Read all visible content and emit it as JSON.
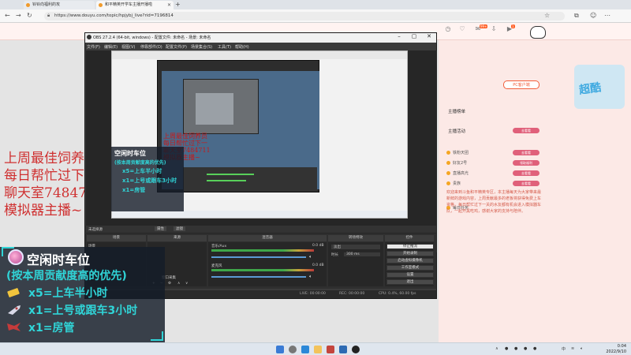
{
  "browser": {
    "tabs": [
      {
        "label": "铃铃向福利的攻"
      },
      {
        "label": "和平精英开学车主播开播啦"
      }
    ],
    "url": "https://www.douyu.com/topic/hpjybj_live?rid=7196814",
    "new_tab_symbol": "+"
  },
  "douyu": {
    "header_badges": [
      "99+",
      "1"
    ],
    "pc_button": "PC客户端",
    "ad_text": "超酷",
    "right_panel": {
      "section1": "主播榜单",
      "section2": "主播活动",
      "rows": [
        "铁粉天团",
        "好友2号",
        "直播高光",
        "贵族",
        "每日任务"
      ],
      "pills": [
        "去看看",
        "去看看",
        "领取福利",
        "去看看",
        "去看看"
      ],
      "paragraph": "欢迎来到斗鱼和平精英专区，本主播每天为大家带来最新鲜的游戏内容，上周贡献最多的老板将获得免费上车资格，每日帮忙过下一关的水友都有机会进入模拟器车队，一起开黑吃鸡，感谢大家的支持与陪伴。"
    }
  },
  "stream_overlay_text": {
    "red_lines": [
      "上周最佳饲养员",
      "每日帮忙过下一",
      "聊天室7484711",
      "模拟器主播~"
    ],
    "panel_title": "空闲时车位",
    "panel_subtitle": "(按本周贡献度高的优先)",
    "items": [
      "x5=上车半小时",
      "x1=上号或跟车3小时",
      "x1=房管"
    ]
  },
  "obs": {
    "title": "OBS 27.2.4 (64-bit, windows) - 配置文件: 未命名 - 场景: 未命名",
    "menu": [
      "文件(F)",
      "编辑(E)",
      "视图(V)",
      "停靠部件(D)",
      "配置文件(P)",
      "场景集合(S)",
      "工具(T)",
      "帮助(H)"
    ],
    "source_bar": {
      "label": "未选择源",
      "props": "属性",
      "filter": "滤镜"
    },
    "docks": {
      "scenes": "场景",
      "sources": "来源",
      "mixer": "混音器",
      "transitions": "转场特效",
      "controls": "控件"
    },
    "scene_list": [
      "场景"
    ],
    "source_list": [
      "窗口采集"
    ],
    "mixer_channels": [
      {
        "name": "音乐/Aux",
        "db": "0.0 dB"
      },
      {
        "name": "麦克风",
        "db": "0.0 dB"
      }
    ],
    "transition": {
      "type": "淡出",
      "duration_label": "时长",
      "duration": "300 ms"
    },
    "controls": [
      "停止推流",
      "开始录制",
      "启动虚拟摄像机",
      "工作室模式",
      "设置",
      "退出"
    ],
    "status": {
      "live": "LIVE: 00:00:00",
      "rec": "REC: 00:00:00",
      "cpu": "CPU: 0.4%, 60.00 fps"
    }
  },
  "taskbar": {
    "time": "0:04",
    "date": "2022/9/10"
  }
}
